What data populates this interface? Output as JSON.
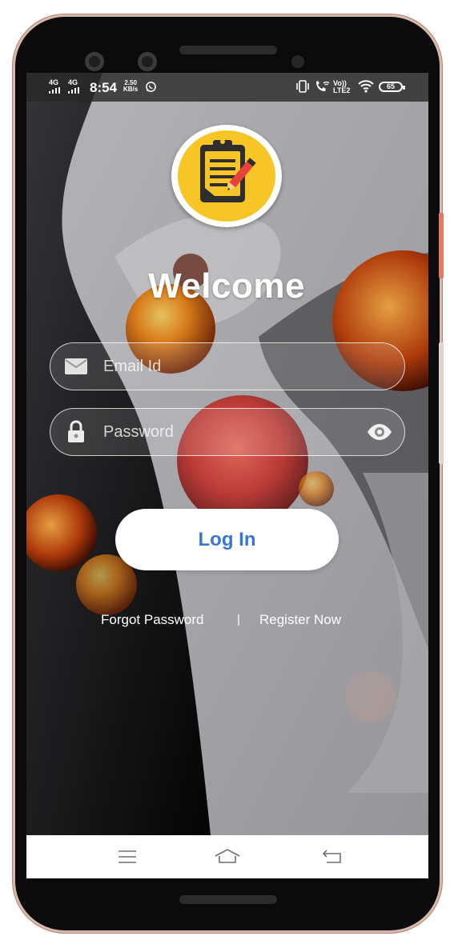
{
  "status_bar": {
    "network_1": "4G",
    "network_2": "4G",
    "time": "8:54",
    "speed_value": "2.50",
    "speed_unit": "KB/s",
    "lte_top": "Vo))",
    "lte_bottom": "LTE2",
    "battery": "65",
    "icons": [
      "whatsapp-icon",
      "vibrate-icon",
      "wifi-call-icon",
      "wifi-icon",
      "battery-icon"
    ]
  },
  "logo": {
    "icon": "clipboard-pencil-icon",
    "background": "#f8c527"
  },
  "welcome": "Welcome",
  "email": {
    "placeholder": "Email Id",
    "icon": "mail-icon"
  },
  "password": {
    "placeholder": "Password",
    "icon": "lock-icon",
    "toggle_icon": "eye-icon"
  },
  "login_label": "Log In",
  "links": {
    "forgot": "Forgot Password",
    "separator": "|",
    "register": "Register Now"
  },
  "nav": {
    "icons": [
      "menu-icon",
      "home-icon",
      "back-icon"
    ]
  },
  "colors": {
    "accent": "#3876d0",
    "logo_yellow": "#f8c527"
  }
}
